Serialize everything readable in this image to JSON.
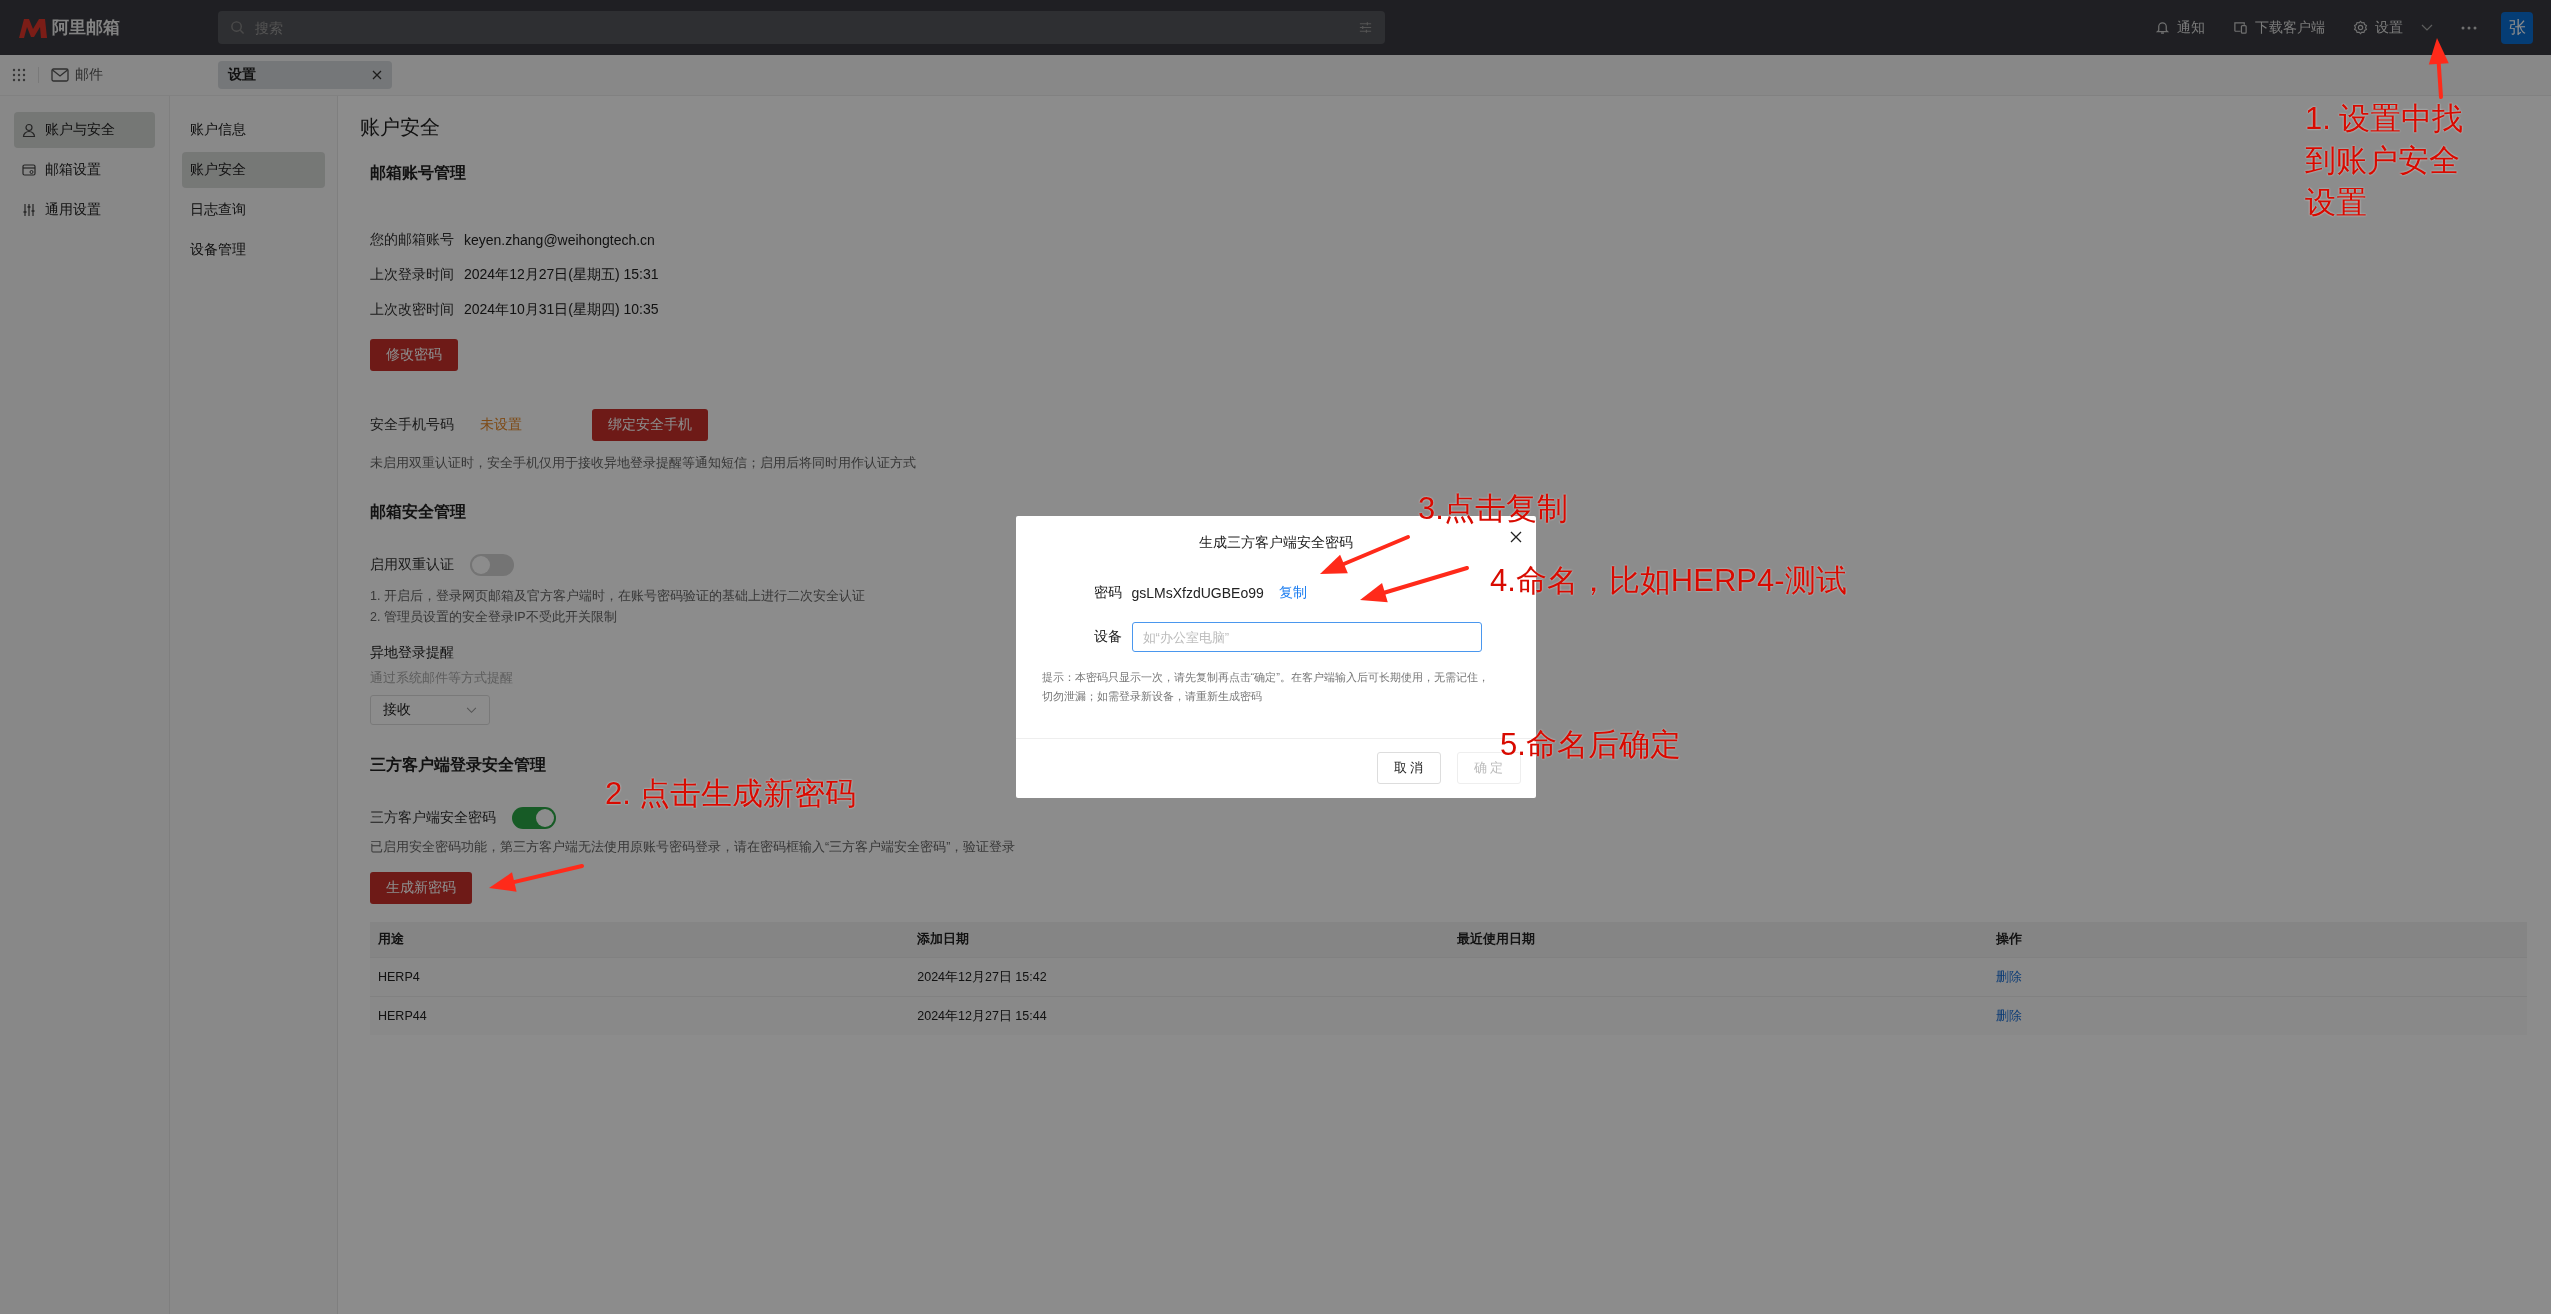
{
  "app": {
    "logo": "阿里邮箱",
    "search_placeholder": "搜索",
    "mail_link": "邮件"
  },
  "header_actions": [
    {
      "kind": "bell",
      "label": "通知"
    },
    {
      "kind": "devices",
      "label": "下载客户端"
    },
    {
      "kind": "gear",
      "label": "设置"
    }
  ],
  "avatar": "张",
  "tabs": [
    {
      "label": "设置",
      "selected": true
    }
  ],
  "nav": [
    {
      "kind": "user",
      "label": "账户与安全",
      "selected": true
    },
    {
      "kind": "mailbox",
      "label": "邮箱设置",
      "selected": false
    },
    {
      "kind": "sliders",
      "label": "通用设置",
      "selected": false
    }
  ],
  "subnav": [
    {
      "label": "账户信息",
      "selected": false
    },
    {
      "label": "账户安全",
      "selected": true
    },
    {
      "label": "日志查询",
      "selected": false
    },
    {
      "label": "设备管理",
      "selected": false
    }
  ],
  "page_title": "账户安全",
  "account": {
    "heading": "邮箱账号管理",
    "fields": [
      {
        "label": "您的邮箱账号",
        "value": "keyen.zhang@weihongtech.cn"
      },
      {
        "label": "上次登录时间",
        "value": "2024年12月27日(星期五) 15:31"
      },
      {
        "label": "上次改密时间",
        "value": "2024年10月31日(星期四) 10:35"
      }
    ],
    "button": "修改密码",
    "phone": {
      "label": "安全手机号码",
      "value": "未设置",
      "button": "绑定安全手机",
      "note": "未启用双重认证时，安全手机仅用于接收异地登录提醒等通知短信；启用后将同时用作认证方式"
    }
  },
  "security": {
    "heading": "邮箱安全管理",
    "two_factor": {
      "label": "启用双重认证",
      "on": false
    },
    "notes": [
      "1. 开启后，登录网页邮箱及官方客户端时，在账号密码验证的基础上进行二次安全认证",
      "2. 管理员设置的安全登录IP不受此开关限制"
    ],
    "remote_login": {
      "heading": "异地登录提醒",
      "hint": "通过系统邮件等方式提醒",
      "value": "接收"
    }
  },
  "third_party": {
    "heading": "三方客户端登录安全管理",
    "toggle": {
      "label": "三方客户端安全密码",
      "on": true
    },
    "note": "已启用安全密码功能，第三方客户端无法使用原账号密码登录，请在密码框输入“三方客户端安全密码”，验证登录",
    "button": "生成新密码",
    "table": {
      "columns": [
        "用途",
        "添加日期",
        "最近使用日期",
        "操作"
      ],
      "rows": [
        {
          "name": "HERP4",
          "added": "2024年12月27日 15:42",
          "action": "删除"
        },
        {
          "name": "HERP44",
          "added": "2024年12月27日 15:44",
          "action": "删除"
        }
      ]
    }
  },
  "dialog": {
    "title": "生成三方客户端安全密码",
    "password_label": "密码",
    "password": "gsLMsXfzdUGBEo99",
    "copy": "复制",
    "device_label": "设备",
    "device_placeholder": "如“办公室电脑”",
    "hint": "提示：本密码只显示一次，请先复制再点击“确定”。在客户端输入后可长期使用，无需记住，切勿泄漏；如需登录新设备，请重新生成密码",
    "buttons": [
      {
        "label": "取 消",
        "disabled": false
      },
      {
        "label": "确 定",
        "disabled": true
      }
    ]
  },
  "annotations": [
    {
      "lines": [
        "1. 设置中找",
        "到账户安全",
        "设置"
      ]
    },
    {
      "lines": [
        "2. 点击生成新密码"
      ]
    },
    {
      "lines": [
        "3.点击复制"
      ]
    },
    {
      "lines": [
        "4.命名，比如HERP4-测试"
      ]
    },
    {
      "lines": [
        "5.命名后确定"
      ]
    }
  ]
}
